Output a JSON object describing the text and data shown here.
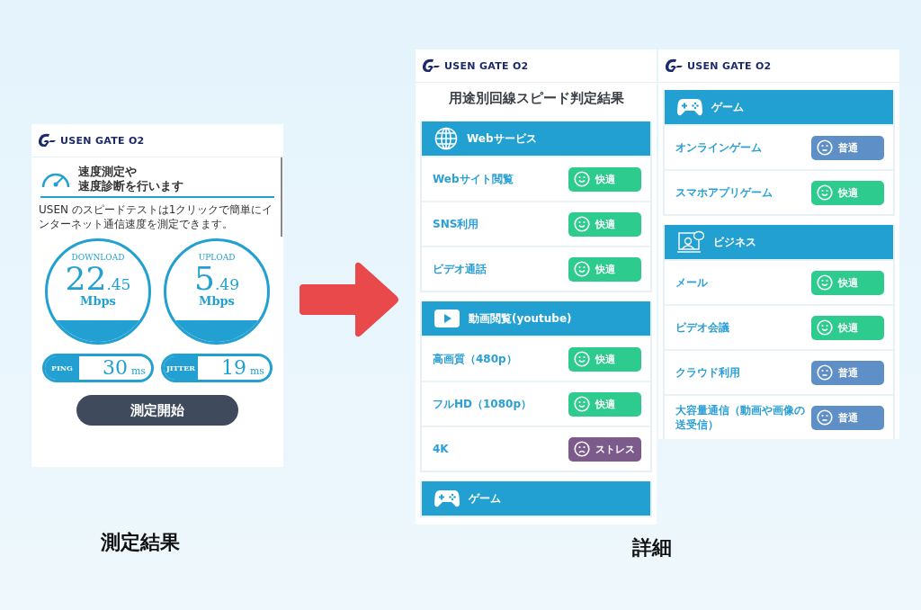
{
  "panels": [
    {
      "kind": "measure",
      "logo": "USEN GATE O2",
      "title_lines": [
        "速度測定や",
        "速度診断を行います"
      ],
      "description": "USEN のスピードテストは1クリックで簡単にインターネット通信速度を測定できます。",
      "gauges": [
        {
          "label": "DOWNLOAD",
          "value_int": "22",
          "value_dec": ".45",
          "unit": "Mbps"
        },
        {
          "label": "UPLOAD",
          "value_int": "5",
          "value_dec": ".49",
          "unit": "Mbps"
        }
      ],
      "stats": [
        {
          "label": "PING",
          "value": "30",
          "unit": "ms"
        },
        {
          "label": "JITTER",
          "value": "19",
          "unit": "ms"
        }
      ],
      "button": "測定開始"
    },
    {
      "kind": "detail",
      "logo": "USEN GATE O2",
      "heading": "用途別回線スピード判定結果",
      "sections": [
        {
          "kind": "web",
          "title": "Webサービス",
          "rows": [
            {
              "label": "Webサイト閲覧",
              "rating": {
                "kind": "good",
                "text": "快適"
              }
            },
            {
              "label": "SNS利用",
              "rating": {
                "kind": "good",
                "text": "快適"
              }
            },
            {
              "label": "ビデオ通話",
              "rating": {
                "kind": "good",
                "text": "快適"
              }
            }
          ]
        },
        {
          "kind": "video",
          "title": "動画閲覧(youtube)",
          "rows": [
            {
              "label": "高画質（480p）",
              "rating": {
                "kind": "good",
                "text": "快適"
              }
            },
            {
              "label": "フルHD（1080p）",
              "rating": {
                "kind": "good",
                "text": "快適"
              }
            },
            {
              "label": "4K",
              "rating": {
                "kind": "stress",
                "text": "ストレス"
              }
            }
          ]
        },
        {
          "kind": "game",
          "title": "ゲーム"
        }
      ]
    },
    {
      "kind": "detail",
      "logo": "USEN GATE O2",
      "sections": [
        {
          "kind": "game",
          "title": "ゲーム",
          "rows": [
            {
              "label": "オンラインゲーム",
              "rating": {
                "kind": "normal",
                "text": "普通"
              }
            },
            {
              "label": "スマホアプリゲーム",
              "rating": {
                "kind": "good",
                "text": "快適"
              }
            }
          ]
        },
        {
          "kind": "business",
          "title": "ビジネス",
          "rows": [
            {
              "label": "メール",
              "rating": {
                "kind": "good",
                "text": "快適"
              }
            },
            {
              "label": "ビデオ会議",
              "rating": {
                "kind": "good",
                "text": "快適"
              }
            },
            {
              "label": "クラウド利用",
              "rating": {
                "kind": "normal",
                "text": "普通"
              }
            },
            {
              "label": "大容量通信（動画や画像の送受信）",
              "rating": {
                "kind": "normal",
                "text": "普通"
              }
            }
          ]
        }
      ]
    }
  ],
  "captions": [
    "測定結果",
    "詳細"
  ]
}
